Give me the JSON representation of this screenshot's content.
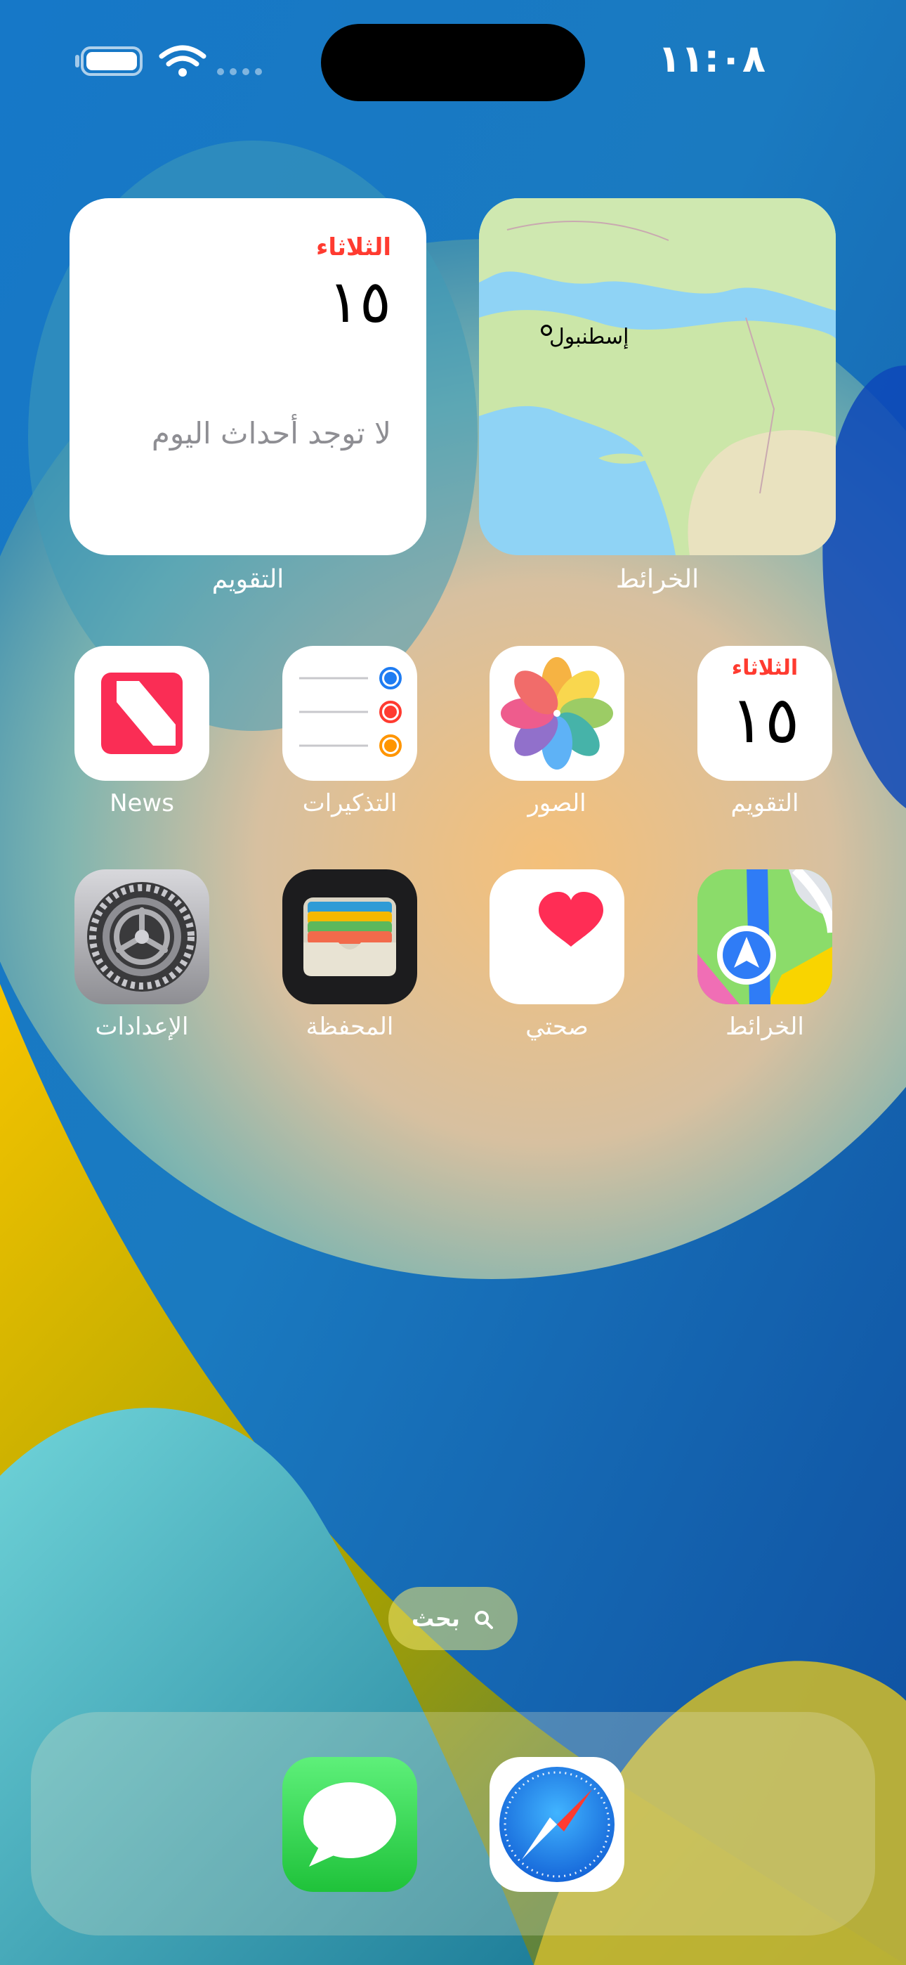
{
  "status_bar": {
    "time": "١١:٠٨"
  },
  "widgets": {
    "calendar": {
      "day": "الثلاثاء",
      "date": "١٥",
      "no_events": "لا توجد أحداث اليوم",
      "label": "التقويم"
    },
    "maps": {
      "city": "إسطنبول",
      "label": "الخرائط"
    }
  },
  "apps": {
    "row1": [
      {
        "label": "News",
        "icon": "news-icon"
      },
      {
        "label": "التذكيرات",
        "icon": "reminders-icon"
      },
      {
        "label": "الصور",
        "icon": "photos-icon"
      },
      {
        "label": "التقويم",
        "icon": "calendar-icon",
        "day": "الثلاثاء",
        "date": "١٥"
      }
    ],
    "row2": [
      {
        "label": "الإعدادات",
        "icon": "settings-icon"
      },
      {
        "label": "المحفظة",
        "icon": "wallet-icon"
      },
      {
        "label": "صحتي",
        "icon": "health-icon"
      },
      {
        "label": "الخرائط",
        "icon": "maps-icon"
      }
    ]
  },
  "search": {
    "label": "بحث"
  },
  "dock": [
    {
      "name": "Messages",
      "icon": "messages-icon"
    },
    {
      "name": "Safari",
      "icon": "safari-icon"
    }
  ],
  "colors": {
    "calendar_red": "#ff3b30",
    "news_red": "#fa2d55",
    "health_red": "#ff2d55",
    "messages_green": "#34c759",
    "safari_blue": "#1e88e5"
  }
}
